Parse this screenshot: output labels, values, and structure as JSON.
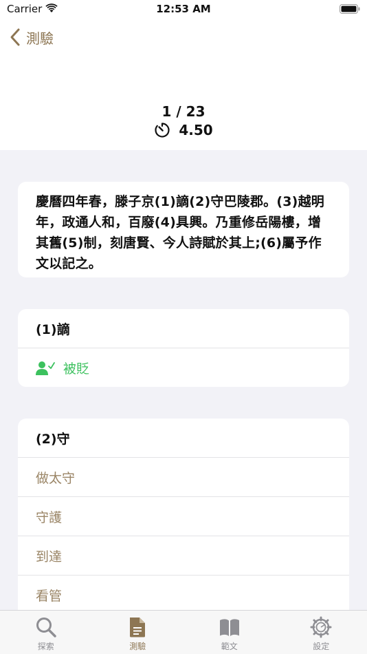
{
  "status": {
    "carrier": "Carrier",
    "time": "12:53 AM"
  },
  "nav": {
    "back_label": "測驗"
  },
  "progress": {
    "text": "1 / 23",
    "timer": "4.50"
  },
  "passage": "慶曆四年春，滕子京(1)謫(2)守巴陵郡。(3)越明年，政通人和，百廢(4)具興。乃重修岳陽樓，增其舊(5)制，刻唐賢、今人詩賦於其上;(6)屬予作文以記之。",
  "questions": [
    {
      "title": "(1)謫",
      "answer": "被貶"
    },
    {
      "title": "(2)守",
      "options": [
        "做太守",
        "守護",
        "到達",
        "看管"
      ]
    }
  ],
  "tabs": [
    {
      "label": "探索",
      "icon": "magnifier-icon"
    },
    {
      "label": "測驗",
      "icon": "document-icon"
    },
    {
      "label": "範文",
      "icon": "book-icon"
    },
    {
      "label": "設定",
      "icon": "gear-icon"
    }
  ],
  "colors": {
    "accent": "#8d7653",
    "correct": "#3cc15e",
    "option_text": "#9a8566",
    "background": "#f2f2f7"
  }
}
